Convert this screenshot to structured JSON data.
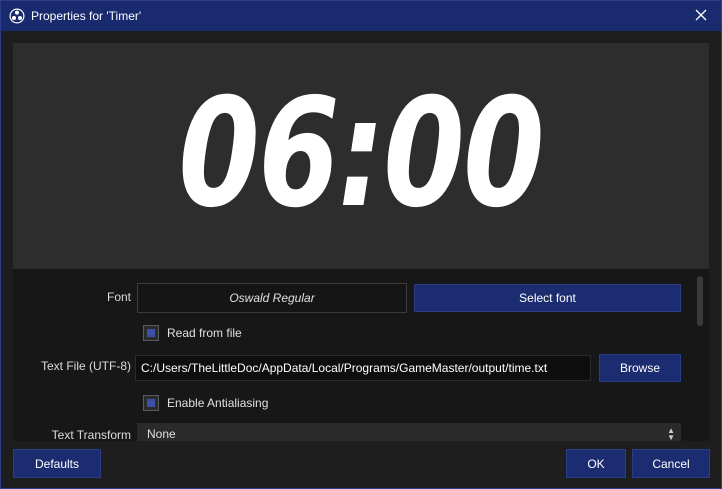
{
  "window": {
    "title": "Properties for 'Timer'"
  },
  "preview": {
    "display_text": "06:00"
  },
  "properties": {
    "font": {
      "label": "Font",
      "value": "Oswald Regular",
      "button": "Select font"
    },
    "read_from_file": {
      "label": "Read from file",
      "checked": true
    },
    "text_file": {
      "label": "Text File (UTF-8)",
      "value": "C:/Users/TheLittleDoc/AppData/Local/Programs/GameMaster/output/time.txt",
      "button": "Browse"
    },
    "antialiasing": {
      "label": "Enable Antialiasing",
      "checked": true
    },
    "text_transform": {
      "label": "Text Transform",
      "value": "None"
    }
  },
  "footer": {
    "defaults": "Defaults",
    "ok": "OK",
    "cancel": "Cancel"
  },
  "colors": {
    "titlebar": "#192a6e",
    "button": "#1c2c70",
    "checkbox_fill": "#3b4fa8"
  }
}
